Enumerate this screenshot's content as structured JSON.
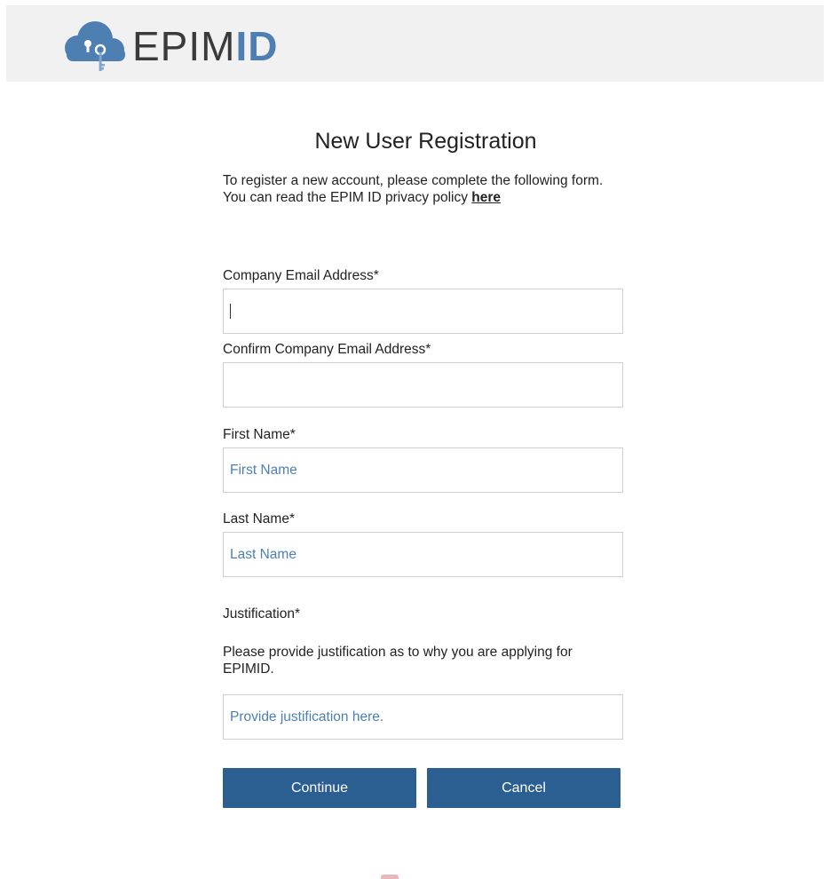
{
  "logo": {
    "text_a": "EPIM",
    "text_b": "ID",
    "icon": "cloud-key-icon",
    "colors": {
      "cloud": "#4d7fb3",
      "dark_text": "#3a3a3a"
    }
  },
  "page": {
    "title": "New User Registration",
    "intro_line1": "To register a new account, please complete the following form.",
    "intro_line2_prefix": "You can read the EPIM ID privacy policy ",
    "privacy_link": "here"
  },
  "form": {
    "email": {
      "label": "Company Email Address*",
      "value": "",
      "placeholder": ""
    },
    "confirm_email": {
      "label": "Confirm Company Email Address*",
      "value": "",
      "placeholder": ""
    },
    "first_name": {
      "label": "First Name*",
      "placeholder": "First Name"
    },
    "last_name": {
      "label": "Last Name*",
      "placeholder": "Last Name"
    },
    "justification": {
      "label": "Justification*",
      "description": "Please provide justification as to why you are applying for EPIMID.",
      "placeholder": "Provide justification here."
    }
  },
  "buttons": {
    "continue": "Continue",
    "cancel": "Cancel"
  },
  "colors": {
    "primary_button": "#2b5f92",
    "placeholder_text": "#4d7fb3",
    "header_bg": "#f1f1f1"
  }
}
